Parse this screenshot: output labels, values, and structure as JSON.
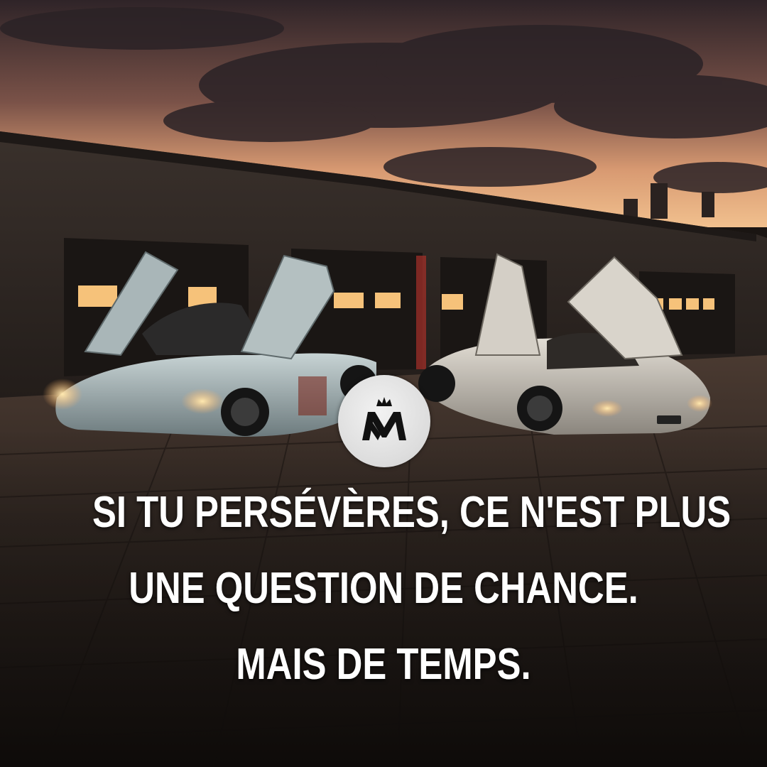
{
  "image": {
    "description_icons": [
      "supercar-left-icon",
      "supercar-right-icon",
      "garage-building-icon",
      "crown-logo-icon"
    ]
  },
  "quote": {
    "lines": [
      "SI TU PERSÉVÈRES, CE N'EST PLUS",
      "UNE QUESTION DE CHANCE.",
      "MAIS DE TEMPS."
    ]
  },
  "colors": {
    "sky_top": "#3a2a2c",
    "sky_glow": "#e7a77a",
    "garage_wall": "#2b2522",
    "garage_light": "#f6c27a",
    "pavement": "#2e2520",
    "car_body_left": "#9fb0b3",
    "car_body_right": "#c9c6bf",
    "text": "#ffffff",
    "logo_bg": "#e0e0e0",
    "logo_fg": "#111111"
  }
}
